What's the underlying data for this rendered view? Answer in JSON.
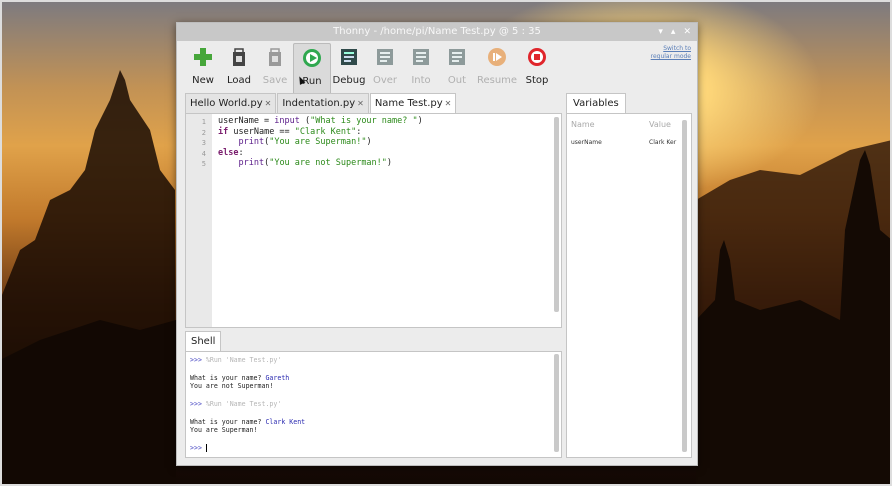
{
  "window": {
    "title": "Thonny  -  /home/pi/Name Test.py  @  5 : 35",
    "controls": [
      "▾",
      "▴",
      "✕"
    ]
  },
  "toolbar": {
    "items": [
      {
        "label": "New",
        "icon": "new-icon",
        "enabled": true
      },
      {
        "label": "Load",
        "icon": "load-icon",
        "enabled": true
      },
      {
        "label": "Save",
        "icon": "save-icon",
        "enabled": false
      },
      {
        "label": "Run",
        "icon": "run-icon",
        "enabled": true
      },
      {
        "label": "Debug",
        "icon": "debug-icon",
        "enabled": true
      },
      {
        "label": "Over",
        "icon": "step-over-icon",
        "enabled": false
      },
      {
        "label": "Into",
        "icon": "step-into-icon",
        "enabled": false
      },
      {
        "label": "Out",
        "icon": "step-out-icon",
        "enabled": false
      },
      {
        "label": "Resume",
        "icon": "resume-icon",
        "enabled": false
      },
      {
        "label": "Stop",
        "icon": "stop-icon",
        "enabled": true
      }
    ],
    "switch_mode": "Switch to regular mode"
  },
  "editor": {
    "tabs": [
      {
        "label": "Hello World.py",
        "close": "✕"
      },
      {
        "label": "Indentation.py",
        "close": "✕"
      },
      {
        "label": "Name Test.py",
        "close": "✕",
        "active": true
      }
    ],
    "line_numbers": [
      "1",
      "2",
      "3",
      "4",
      "5"
    ]
  },
  "shell": {
    "tab_label": "Shell",
    "prompt": ">>>",
    "run_cmd": " %Run 'Name Test.py'",
    "q1": "What is your name? ",
    "a1": "Gareth",
    "r1": "You are not Superman!",
    "q2": "What is your name? ",
    "a2": "Clark Kent",
    "r2": "You are Superman!"
  },
  "variables": {
    "tab_label": "Variables",
    "col_name": "Name",
    "col_value": "Value",
    "rows": [
      {
        "name": "userName",
        "value": "Clark Ker"
      }
    ]
  },
  "colors": {
    "accent_run": "#2fa84f",
    "stop": "#e0252b",
    "new": "#46a63a"
  }
}
